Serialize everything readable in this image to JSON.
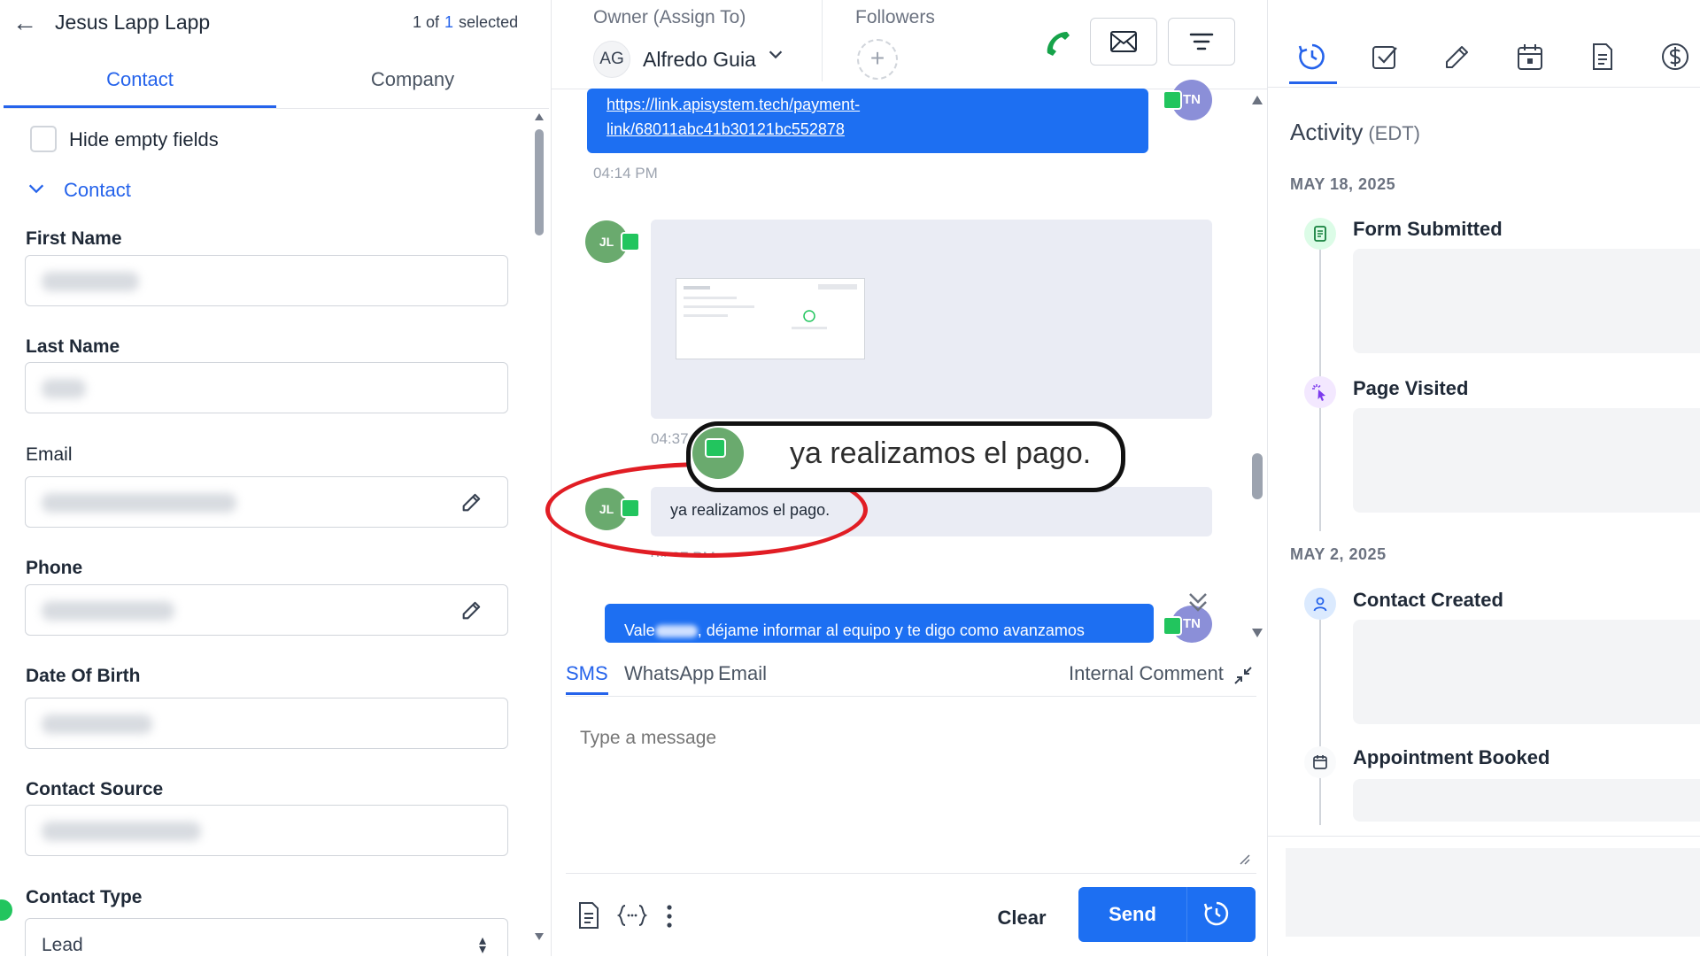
{
  "header": {
    "back_icon": "arrow-left-icon",
    "contact_name": "Jesus Lapp Lapp",
    "selection_prefix": "1 of",
    "selection_count": "1",
    "selection_suffix": "selected"
  },
  "contact_panel": {
    "tabs": [
      {
        "label": "Contact",
        "active": true
      },
      {
        "label": "Company",
        "active": false
      }
    ],
    "hide_empty_label": "Hide empty fields",
    "hide_empty_checked": false,
    "section_title": "Contact",
    "fields": {
      "first_name": "First Name",
      "last_name": "Last Name",
      "email": "Email",
      "phone": "Phone",
      "date_of_birth": "Date Of Birth",
      "contact_source": "Contact Source",
      "contact_type": "Contact Type"
    },
    "contact_type_value": "Lead"
  },
  "conversation": {
    "owner_label": "Owner (Assign To)",
    "owner_initials": "AG",
    "owner_name": "Alfredo Guia",
    "followers_label": "Followers",
    "add_follower_symbol": "+",
    "messages": [
      {
        "direction": "out",
        "text_line1": "https://link.apisystem.tech/payment-",
        "text_line2": "link/68011abc41b30121bc552878",
        "avatar": "TN",
        "time": "04:14 PM"
      },
      {
        "direction": "in",
        "type": "image",
        "avatar": "JL",
        "time": "04:37"
      },
      {
        "direction": "in",
        "text": "ya realizamos el pago.",
        "avatar": "JL",
        "time": "04:37 PM"
      },
      {
        "direction": "out",
        "text_prefix": "Vale",
        "text": ", déjame informar al equipo y te digo como avanzamos",
        "avatar": "TN"
      }
    ],
    "callout_text": "ya realizamos el pago.",
    "compose": {
      "tabs": [
        {
          "label": "SMS",
          "active": true
        },
        {
          "label": "WhatsApp",
          "active": false
        },
        {
          "label": "Email",
          "active": false
        }
      ],
      "internal_comment": "Internal Comment",
      "placeholder": "Type a message",
      "clear_label": "Clear",
      "send_label": "Send"
    }
  },
  "activity": {
    "title": "Activity",
    "timezone": "(EDT)",
    "top_icons": [
      "clock-icon",
      "checkbox-icon",
      "pencil-icon",
      "calendar-icon",
      "document-icon",
      "dollar-icon"
    ],
    "groups": [
      {
        "date": "MAY 18, 2025",
        "events": [
          {
            "title": "Form Submitted",
            "icon": "form-icon"
          },
          {
            "title": "Page Visited",
            "icon": "cursor-click-icon"
          }
        ]
      },
      {
        "date": "MAY 2, 2025",
        "events": [
          {
            "title": "Contact Created",
            "icon": "user-icon"
          },
          {
            "title": "Appointment Booked",
            "icon": "calendar-icon"
          }
        ]
      }
    ]
  },
  "colors": {
    "accent": "#2563eb",
    "outgoing_bubble": "#1d6ff2",
    "incoming_bubble": "#eaecf4",
    "annotation_red": "#e11d24"
  }
}
